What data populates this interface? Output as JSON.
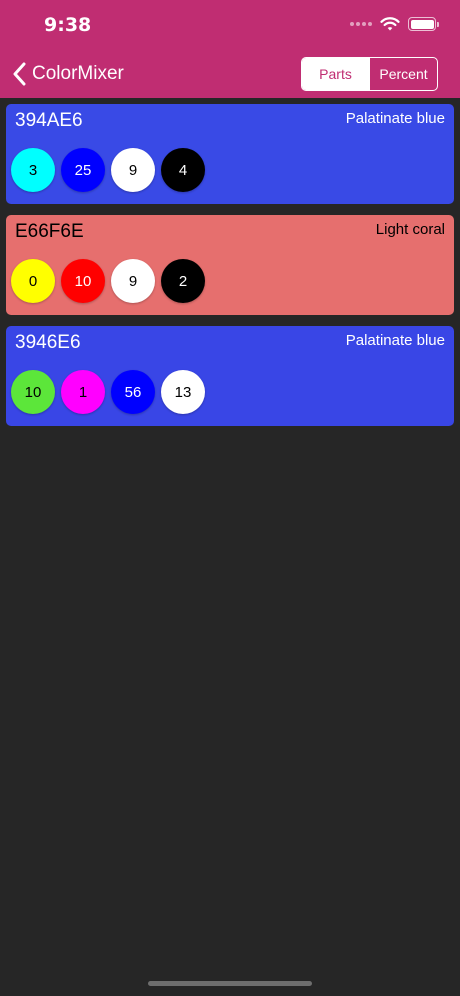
{
  "status_bar": {
    "time": "9:38"
  },
  "nav": {
    "back_label": "ColorMixer",
    "segments": [
      {
        "label": "Parts",
        "selected": true
      },
      {
        "label": "Percent",
        "selected": false
      }
    ]
  },
  "colors": {
    "header_bg": "#c02d72",
    "page_bg": "#262626"
  },
  "mixes": [
    {
      "hex": "394AE6",
      "name": "Palatinate blue",
      "bg": "#394ae6",
      "text_color": "#ffffff",
      "parts": [
        {
          "value": "3",
          "color": "#00ffff",
          "text_color": "#000000"
        },
        {
          "value": "25",
          "color": "#0000ff",
          "text_color": "#ffffff"
        },
        {
          "value": "9",
          "color": "#ffffff",
          "text_color": "#000000"
        },
        {
          "value": "4",
          "color": "#000000",
          "text_color": "#ffffff"
        }
      ]
    },
    {
      "hex": "E66F6E",
      "name": "Light coral",
      "bg": "#e66f6e",
      "text_color": "#000000",
      "parts": [
        {
          "value": "0",
          "color": "#ffff00",
          "text_color": "#000000"
        },
        {
          "value": "10",
          "color": "#ff0000",
          "text_color": "#ffffff"
        },
        {
          "value": "9",
          "color": "#ffffff",
          "text_color": "#000000"
        },
        {
          "value": "2",
          "color": "#000000",
          "text_color": "#ffffff"
        }
      ]
    },
    {
      "hex": "3946E6",
      "name": "Palatinate blue",
      "bg": "#3946e6",
      "text_color": "#ffffff",
      "parts": [
        {
          "value": "10",
          "color": "#5ce63a",
          "text_color": "#000000"
        },
        {
          "value": "1",
          "color": "#ff00ff",
          "text_color": "#000000"
        },
        {
          "value": "56",
          "color": "#0000ff",
          "text_color": "#ffffff"
        },
        {
          "value": "13",
          "color": "#ffffff",
          "text_color": "#000000"
        }
      ]
    }
  ]
}
